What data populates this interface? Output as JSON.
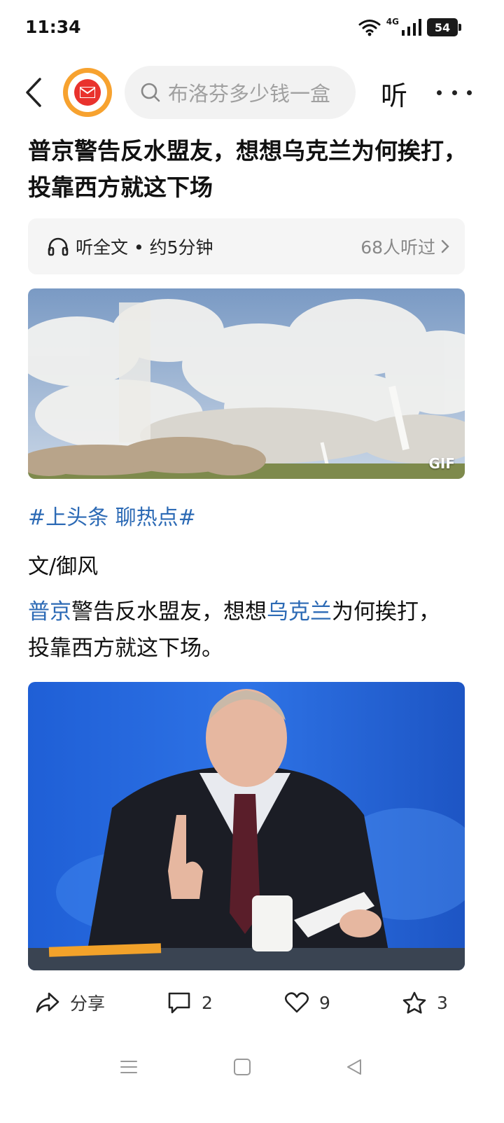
{
  "status": {
    "time": "11:34",
    "network": "4G",
    "battery": "54"
  },
  "nav": {
    "search_placeholder": "布洛芬多少钱一盒",
    "listen_label": "听"
  },
  "article": {
    "title": "普京警告反水盟友，想想乌克兰为何挨打，投靠西方就这下场",
    "listen_full": "听全文 • 约5分钟",
    "listen_count": "68人听过",
    "gif_label": "GIF",
    "hashtag": "#上头条 聊热点#",
    "byline": "文/御风",
    "para": {
      "link1": "普京",
      "text1": "警告反水盟友，想想",
      "link2": "乌克兰",
      "text2": "为何挨打，投靠西方就这下场。"
    }
  },
  "actions": {
    "share_label": "分享",
    "comment_count": "2",
    "like_count": "9",
    "favorite_count": "3"
  },
  "icons": {
    "back": "back-chevron-icon",
    "search": "search-icon",
    "headphones": "headphones-icon",
    "share": "share-icon",
    "comment": "comment-icon",
    "like": "heart-icon",
    "favorite": "star-icon"
  },
  "colors": {
    "link": "#2c6ab5",
    "logo_ring": "#f7a22f",
    "logo_core": "#e9322d"
  }
}
